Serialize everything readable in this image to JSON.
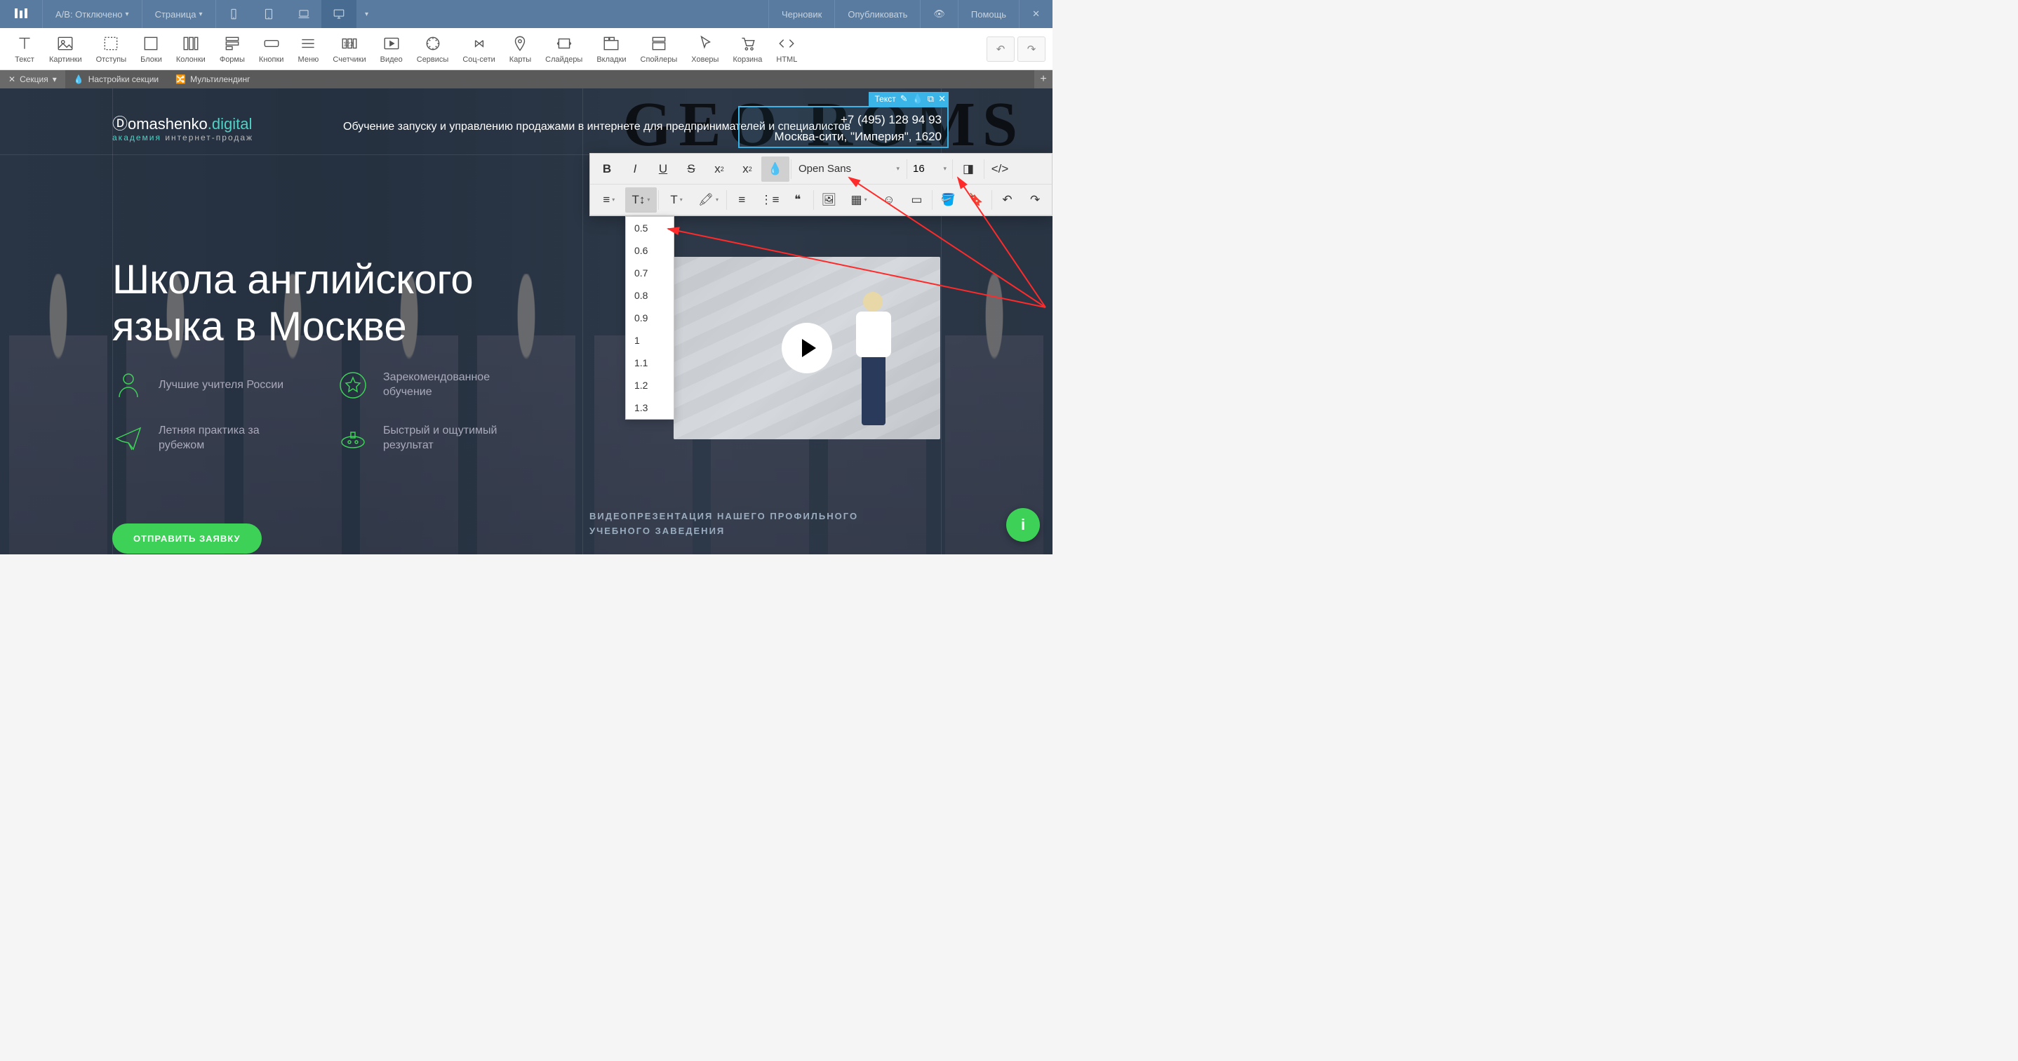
{
  "topbar": {
    "ab_label": "A/B: Отключено",
    "page_label": "Страница",
    "draft": "Черновик",
    "publish": "Опубликовать",
    "help": "Помощь"
  },
  "toolbar": [
    {
      "id": "text",
      "label": "Текст"
    },
    {
      "id": "images",
      "label": "Картинки"
    },
    {
      "id": "padding",
      "label": "Отступы"
    },
    {
      "id": "blocks",
      "label": "Блоки"
    },
    {
      "id": "columns",
      "label": "Колонки"
    },
    {
      "id": "forms",
      "label": "Формы"
    },
    {
      "id": "buttons",
      "label": "Кнопки"
    },
    {
      "id": "menu",
      "label": "Меню"
    },
    {
      "id": "counters",
      "label": "Счетчики"
    },
    {
      "id": "video",
      "label": "Видео"
    },
    {
      "id": "services",
      "label": "Сервисы"
    },
    {
      "id": "social",
      "label": "Соц-сети"
    },
    {
      "id": "maps",
      "label": "Карты"
    },
    {
      "id": "sliders",
      "label": "Слайдеры"
    },
    {
      "id": "tabs",
      "label": "Вкладки"
    },
    {
      "id": "spoilers",
      "label": "Спойлеры"
    },
    {
      "id": "hovers",
      "label": "Ховеры"
    },
    {
      "id": "cart",
      "label": "Корзина"
    },
    {
      "id": "html",
      "label": "HTML"
    }
  ],
  "section_tabs": {
    "section": "Секция",
    "settings": "Настройки секции",
    "multi": "Мультилендинг"
  },
  "brand": {
    "name_pre": "Ⓓomashenko",
    "name_suf": ".digital",
    "sub_pre": "академия",
    "sub_suf": " интернет-продаж"
  },
  "tagline": "Обучение запуску и управлению продажами в интернете для предпринимателей и специалистов",
  "selected_block": {
    "label": "Текст",
    "phone": "+7 (495) 128 94 93",
    "address": "Москва-сити,  \"Империя\", 1620"
  },
  "rte": {
    "font": "Open Sans",
    "size": "16",
    "line_heights": [
      "0.5",
      "0.6",
      "0.7",
      "0.8",
      "0.9",
      "1",
      "1.1",
      "1.2",
      "1.3"
    ]
  },
  "hero": {
    "line1": "Школа английского",
    "line2": "языка в Москве"
  },
  "features": [
    "Лучшие учителя России",
    "Зарекомендованное обучение",
    "Летняя практика за рубежом",
    "Быстрый и ощутимый результат"
  ],
  "cta": "ОТПРАВИТЬ ЗАЯВКУ",
  "video_caption": {
    "line1": "ВИДЕОПРЕЗЕНТАЦИЯ НАШЕГО ПРОФИЛЬНОГО",
    "line2": "УЧЕБНОГО ЗАВЕДЕНИЯ"
  },
  "bg_text": "GEO ROMS"
}
